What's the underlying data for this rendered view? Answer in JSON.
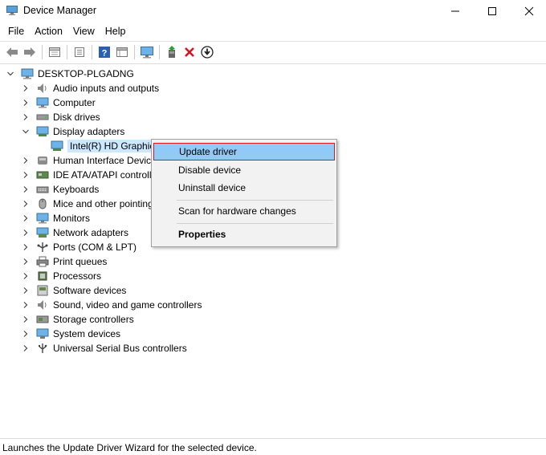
{
  "window": {
    "title": "Device Manager",
    "minimize_glyph": "—",
    "maximize_glyph": "☐",
    "close_glyph": "✕"
  },
  "menu": [
    "File",
    "Action",
    "View",
    "Help"
  ],
  "toolbar": {
    "icons": [
      "back-arrow-icon",
      "forward-arrow-icon",
      "properties-pane-icon",
      "details-icon",
      "help-icon",
      "show-hide-pane-icon",
      "scan-hardware-icon",
      "add-driver-icon",
      "uninstall-x-icon",
      "update-down-arrow-icon"
    ]
  },
  "tree": {
    "root": "DESKTOP-PLGADNG",
    "categories": [
      "Audio inputs and outputs",
      "Computer",
      "Disk drives",
      "Display adapters",
      "Intel(R) HD Graphics",
      "Human Interface Devices",
      "IDE ATA/ATAPI controllers",
      "Keyboards",
      "Mice and other pointing devices",
      "Monitors",
      "Network adapters",
      "Ports (COM & LPT)",
      "Print queues",
      "Processors",
      "Software devices",
      "Sound, video and game controllers",
      "Storage controllers",
      "System devices",
      "Universal Serial Bus controllers"
    ]
  },
  "context_menu": {
    "items": [
      "Update driver",
      "Disable device",
      "Uninstall device",
      "Scan for hardware changes",
      "Properties"
    ]
  },
  "status": "Launches the Update Driver Wizard for the selected device.",
  "colors": {
    "selection": "#cce8ff",
    "menu_highlight": "#91c9f7",
    "highlight_border": "#e0141e"
  }
}
